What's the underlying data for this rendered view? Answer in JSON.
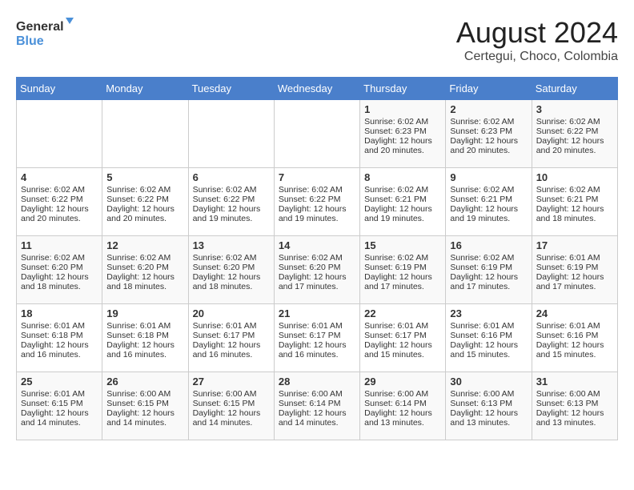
{
  "header": {
    "logo_line1": "General",
    "logo_line2": "Blue",
    "title": "August 2024",
    "subtitle": "Certegui, Choco, Colombia"
  },
  "days_of_week": [
    "Sunday",
    "Monday",
    "Tuesday",
    "Wednesday",
    "Thursday",
    "Friday",
    "Saturday"
  ],
  "weeks": [
    [
      {
        "day": "",
        "content": ""
      },
      {
        "day": "",
        "content": ""
      },
      {
        "day": "",
        "content": ""
      },
      {
        "day": "",
        "content": ""
      },
      {
        "day": "1",
        "content": "Sunrise: 6:02 AM\nSunset: 6:23 PM\nDaylight: 12 hours\nand 20 minutes."
      },
      {
        "day": "2",
        "content": "Sunrise: 6:02 AM\nSunset: 6:23 PM\nDaylight: 12 hours\nand 20 minutes."
      },
      {
        "day": "3",
        "content": "Sunrise: 6:02 AM\nSunset: 6:22 PM\nDaylight: 12 hours\nand 20 minutes."
      }
    ],
    [
      {
        "day": "4",
        "content": "Sunrise: 6:02 AM\nSunset: 6:22 PM\nDaylight: 12 hours\nand 20 minutes."
      },
      {
        "day": "5",
        "content": "Sunrise: 6:02 AM\nSunset: 6:22 PM\nDaylight: 12 hours\nand 20 minutes."
      },
      {
        "day": "6",
        "content": "Sunrise: 6:02 AM\nSunset: 6:22 PM\nDaylight: 12 hours\nand 19 minutes."
      },
      {
        "day": "7",
        "content": "Sunrise: 6:02 AM\nSunset: 6:22 PM\nDaylight: 12 hours\nand 19 minutes."
      },
      {
        "day": "8",
        "content": "Sunrise: 6:02 AM\nSunset: 6:21 PM\nDaylight: 12 hours\nand 19 minutes."
      },
      {
        "day": "9",
        "content": "Sunrise: 6:02 AM\nSunset: 6:21 PM\nDaylight: 12 hours\nand 19 minutes."
      },
      {
        "day": "10",
        "content": "Sunrise: 6:02 AM\nSunset: 6:21 PM\nDaylight: 12 hours\nand 18 minutes."
      }
    ],
    [
      {
        "day": "11",
        "content": "Sunrise: 6:02 AM\nSunset: 6:20 PM\nDaylight: 12 hours\nand 18 minutes."
      },
      {
        "day": "12",
        "content": "Sunrise: 6:02 AM\nSunset: 6:20 PM\nDaylight: 12 hours\nand 18 minutes."
      },
      {
        "day": "13",
        "content": "Sunrise: 6:02 AM\nSunset: 6:20 PM\nDaylight: 12 hours\nand 18 minutes."
      },
      {
        "day": "14",
        "content": "Sunrise: 6:02 AM\nSunset: 6:20 PM\nDaylight: 12 hours\nand 17 minutes."
      },
      {
        "day": "15",
        "content": "Sunrise: 6:02 AM\nSunset: 6:19 PM\nDaylight: 12 hours\nand 17 minutes."
      },
      {
        "day": "16",
        "content": "Sunrise: 6:02 AM\nSunset: 6:19 PM\nDaylight: 12 hours\nand 17 minutes."
      },
      {
        "day": "17",
        "content": "Sunrise: 6:01 AM\nSunset: 6:19 PM\nDaylight: 12 hours\nand 17 minutes."
      }
    ],
    [
      {
        "day": "18",
        "content": "Sunrise: 6:01 AM\nSunset: 6:18 PM\nDaylight: 12 hours\nand 16 minutes."
      },
      {
        "day": "19",
        "content": "Sunrise: 6:01 AM\nSunset: 6:18 PM\nDaylight: 12 hours\nand 16 minutes."
      },
      {
        "day": "20",
        "content": "Sunrise: 6:01 AM\nSunset: 6:17 PM\nDaylight: 12 hours\nand 16 minutes."
      },
      {
        "day": "21",
        "content": "Sunrise: 6:01 AM\nSunset: 6:17 PM\nDaylight: 12 hours\nand 16 minutes."
      },
      {
        "day": "22",
        "content": "Sunrise: 6:01 AM\nSunset: 6:17 PM\nDaylight: 12 hours\nand 15 minutes."
      },
      {
        "day": "23",
        "content": "Sunrise: 6:01 AM\nSunset: 6:16 PM\nDaylight: 12 hours\nand 15 minutes."
      },
      {
        "day": "24",
        "content": "Sunrise: 6:01 AM\nSunset: 6:16 PM\nDaylight: 12 hours\nand 15 minutes."
      }
    ],
    [
      {
        "day": "25",
        "content": "Sunrise: 6:01 AM\nSunset: 6:15 PM\nDaylight: 12 hours\nand 14 minutes."
      },
      {
        "day": "26",
        "content": "Sunrise: 6:00 AM\nSunset: 6:15 PM\nDaylight: 12 hours\nand 14 minutes."
      },
      {
        "day": "27",
        "content": "Sunrise: 6:00 AM\nSunset: 6:15 PM\nDaylight: 12 hours\nand 14 minutes."
      },
      {
        "day": "28",
        "content": "Sunrise: 6:00 AM\nSunset: 6:14 PM\nDaylight: 12 hours\nand 14 minutes."
      },
      {
        "day": "29",
        "content": "Sunrise: 6:00 AM\nSunset: 6:14 PM\nDaylight: 12 hours\nand 13 minutes."
      },
      {
        "day": "30",
        "content": "Sunrise: 6:00 AM\nSunset: 6:13 PM\nDaylight: 12 hours\nand 13 minutes."
      },
      {
        "day": "31",
        "content": "Sunrise: 6:00 AM\nSunset: 6:13 PM\nDaylight: 12 hours\nand 13 minutes."
      }
    ]
  ]
}
